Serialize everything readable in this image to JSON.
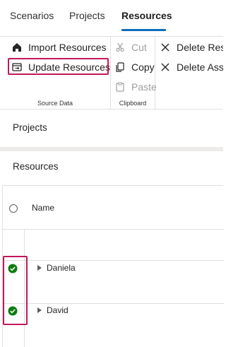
{
  "tabs": [
    {
      "label": "Scenarios"
    },
    {
      "label": "Projects"
    },
    {
      "label": "Resources",
      "active": true
    }
  ],
  "ribbon": {
    "source_data": {
      "group_label": "Source Data",
      "import_label": "Import Resources",
      "update_label": "Update Resources"
    },
    "clipboard": {
      "group_label": "Clipboard",
      "cut_label": "Cut",
      "copy_label": "Copy",
      "paste_label": "Paste"
    },
    "delete": {
      "delete_resource_label": "Delete Reso",
      "delete_assignment_label": "Delete Assi"
    }
  },
  "sections": {
    "projects_label": "Projects",
    "resources_label": "Resources"
  },
  "grid": {
    "name_header": "Name",
    "rows": [
      {
        "name": "Daniela",
        "status": "valid"
      },
      {
        "name": "David",
        "status": "valid"
      }
    ]
  },
  "colors": {
    "accent": "#0f6cbd",
    "highlight": "#c2185b",
    "check": "#107c10"
  }
}
